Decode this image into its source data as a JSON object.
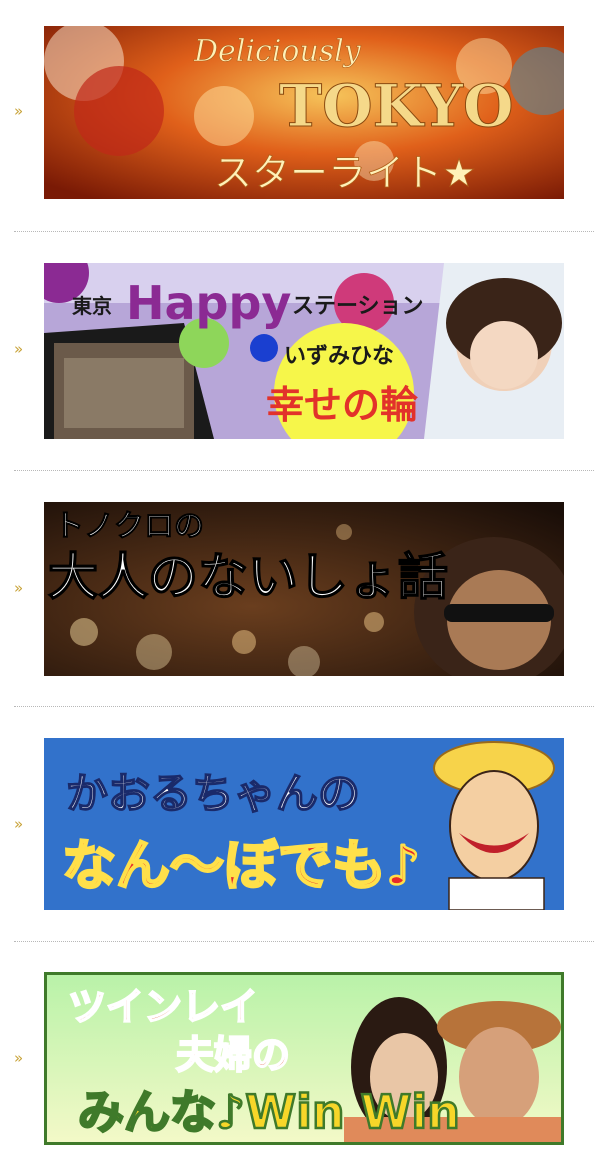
{
  "arrow_glyph": "»",
  "banners": [
    {
      "lines": [
        "Deliciously",
        "TOKYO",
        "スターライト★"
      ],
      "colors": {
        "bg_start": "#7a1a05",
        "bg_mid": "#e0601a",
        "bg_end": "#f4b84a",
        "text": "#fff1b8"
      }
    },
    {
      "lines": [
        "東京",
        "Happy",
        "ステーション",
        "いずみひな",
        "幸せの輪"
      ],
      "colors": {
        "bg": "#b7a6d8",
        "title": "#1a1a1a",
        "happy": "#8b2a93",
        "circle": "#f6f64a",
        "text_red": "#e2322a"
      }
    },
    {
      "lines": [
        "トノクロの",
        "大人のないしょ話"
      ],
      "colors": {
        "bg": "#2a1a12",
        "text": "#ffffff"
      }
    },
    {
      "lines": [
        "かおるちゃんの",
        "なん～ぼでも♪"
      ],
      "colors": {
        "bg": "#2f6ec6",
        "text1": "#ffffff",
        "text2": "#e72a2a",
        "outline": "#ffe04a"
      }
    },
    {
      "lines": [
        "ツインレイ",
        "夫婦の",
        "みんな♪Win Win"
      ],
      "colors": {
        "bg_top": "#b8f2a8",
        "bg_bottom": "#f4f9c8",
        "border": "#3f7a2a",
        "text": "#e23a1a",
        "text2": "#f7d629"
      }
    }
  ]
}
